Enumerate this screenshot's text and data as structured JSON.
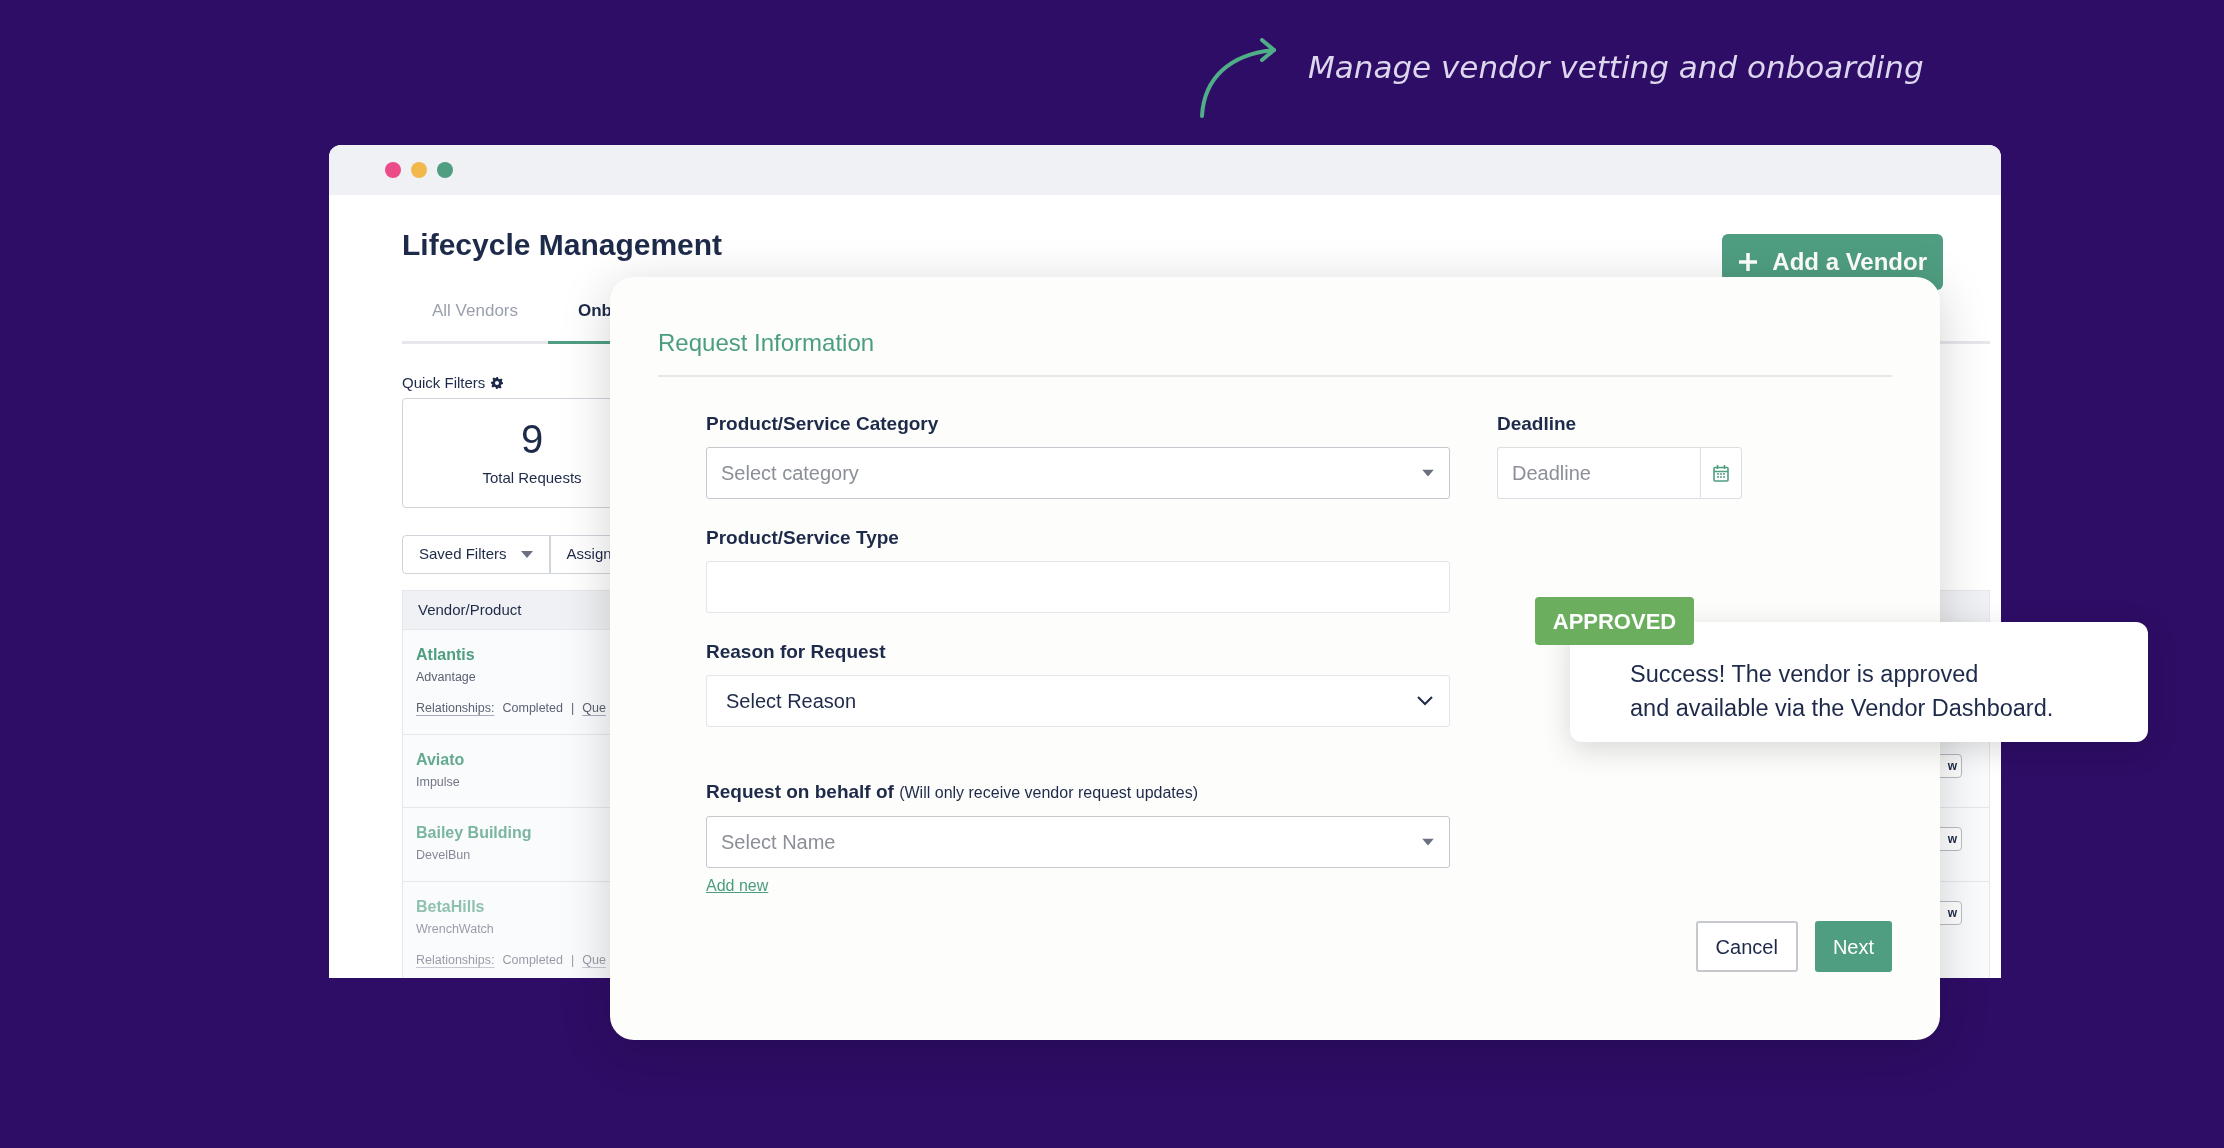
{
  "tagline": {
    "text": "Manage vendor vetting and onboarding"
  },
  "window": {
    "title": "Lifecycle Management"
  },
  "add_button": {
    "label": "Add a Vendor"
  },
  "tabs": [
    {
      "label": "All Vendors",
      "selected": false
    },
    {
      "label": "Onb",
      "selected": true
    }
  ],
  "quick_filters": {
    "label": "Quick Filters",
    "cards": [
      {
        "count": "9",
        "label": "Total Requests"
      }
    ]
  },
  "filter_buttons": [
    {
      "label": "Saved Filters",
      "kind": "dropdown"
    },
    {
      "label": "Assign",
      "kind": "plain"
    }
  ],
  "table": {
    "columns": [
      "Vendor/Product"
    ],
    "rows": [
      {
        "vendor": "Atlantis",
        "product": "Advantage",
        "details": [
          {
            "kind": "link",
            "text": "Relationships:"
          },
          {
            "kind": "text",
            "text": "Completed"
          },
          {
            "kind": "separator",
            "text": "|"
          },
          {
            "kind": "link",
            "text": "Que"
          }
        ]
      },
      {
        "vendor": "Aviato",
        "product": "Impulse",
        "action": "w"
      },
      {
        "vendor": "Bailey Building",
        "product": "DevelBun",
        "action": "w"
      },
      {
        "vendor": "BetaHills",
        "product": "WrenchWatch",
        "details": [
          {
            "kind": "link",
            "text": "Relationships:"
          },
          {
            "kind": "text",
            "text": "Completed"
          },
          {
            "kind": "separator",
            "text": "|"
          },
          {
            "kind": "link",
            "text": "Que"
          }
        ],
        "action": "w"
      }
    ]
  },
  "modal": {
    "title": "Request Information",
    "fields": [
      {
        "kind": "dropdown",
        "label": "Product/Service Category",
        "placeholder": "Select category"
      },
      {
        "kind": "text",
        "label": "Product/Service Type"
      },
      {
        "kind": "select",
        "label": "Reason for Request",
        "value": "Select Reason"
      },
      {
        "kind": "dropdown",
        "label": "Request on behalf of",
        "note": "(Will only receive vendor request updates)",
        "placeholder": "Select Name",
        "link": "Add new"
      }
    ],
    "deadline": {
      "label": "Deadline",
      "placeholder": "Deadline"
    },
    "buttons": [
      {
        "label": "Cancel",
        "kind": "secondary"
      },
      {
        "label": "Next",
        "kind": "primary"
      }
    ]
  },
  "toast": {
    "badge": "APPROVED",
    "message": "Success! The vendor is approved\nand available via the Vendor Dashboard."
  }
}
